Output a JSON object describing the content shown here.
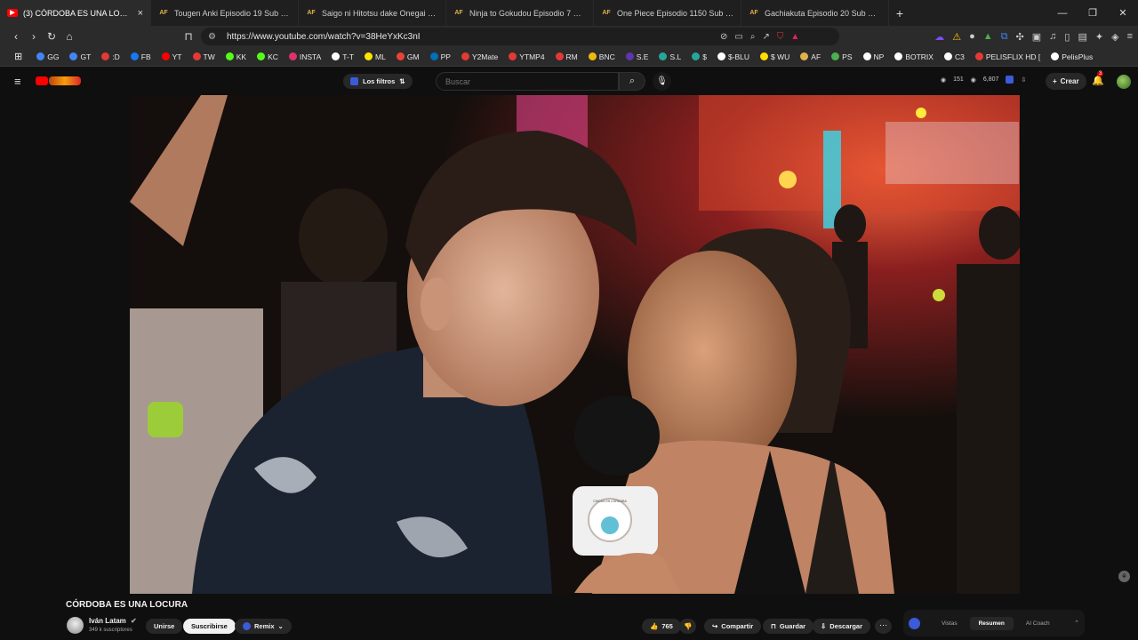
{
  "browser": {
    "tabs": [
      {
        "label": "(3) CÓRDOBA ES UNA LOCURA",
        "favicon": "youtube-favicon",
        "active": true
      },
      {
        "label": "Tougen Anki Episodio 19 Sub Españo",
        "favicon": "animeflv-favicon",
        "active": false
      },
      {
        "label": "Saigo ni Hitotsu dake Onegai shitem",
        "favicon": "animeflv-favicon",
        "active": false
      },
      {
        "label": "Ninja to Gokudou Episodio 7 Sub Esp",
        "favicon": "animeflv-favicon",
        "active": false
      },
      {
        "label": "One Piece Episodio 1150 Sub Españo",
        "favicon": "animeflv-favicon",
        "active": false
      },
      {
        "label": "Gachiakuta Episodio 20 Sub Españo",
        "favicon": "animeflv-favicon",
        "active": false
      }
    ],
    "url": "https://www.youtube.com/watch?v=38HeYxKc3nI",
    "bookmarks": [
      {
        "label": "GG",
        "color": "#4285f4"
      },
      {
        "label": "GT",
        "color": "#4285f4"
      },
      {
        "label": ":D",
        "color": "#e53935"
      },
      {
        "label": "FB",
        "color": "#1877f2"
      },
      {
        "label": "YT",
        "color": "#ff0000"
      },
      {
        "label": "TW",
        "color": "#e53935"
      },
      {
        "label": "KK",
        "color": "#53fc18"
      },
      {
        "label": "KC",
        "color": "#53fc18"
      },
      {
        "label": "INSTA",
        "color": "#e1306c"
      },
      {
        "label": "T-T",
        "color": "#ffffff"
      },
      {
        "label": "ML",
        "color": "#ffe600"
      },
      {
        "label": "GM",
        "color": "#ea4335"
      },
      {
        "label": "PP",
        "color": "#0070ba"
      },
      {
        "label": "Y2Mate",
        "color": "#e53935"
      },
      {
        "label": "YTMP4",
        "color": "#e53935"
      },
      {
        "label": "RM",
        "color": "#e53935"
      },
      {
        "label": "BNC",
        "color": "#f0b90b"
      },
      {
        "label": "S.E",
        "color": "#5e35b1"
      },
      {
        "label": "S.L",
        "color": "#26a69a"
      },
      {
        "label": "$",
        "color": "#26a69a"
      },
      {
        "label": "$-BLU",
        "color": "#ffffff"
      },
      {
        "label": "$ WU",
        "color": "#ffdd00"
      },
      {
        "label": "AF",
        "color": "#e0b24a"
      },
      {
        "label": "PS",
        "color": "#4caf50"
      },
      {
        "label": "NP",
        "color": "#ffffff"
      },
      {
        "label": "BOTRIX",
        "color": "#ffffff"
      },
      {
        "label": "C3",
        "color": "#ffffff"
      },
      {
        "label": "PELISFLIX HD [",
        "color": "#e53935"
      },
      {
        "label": "PelisPlus",
        "color": "#ffffff"
      }
    ]
  },
  "youtube": {
    "filters_label": "Los filtros",
    "search_placeholder": "Buscar",
    "stat_a": "151",
    "stat_b": "6,807",
    "create_label": "Crear",
    "notifications": "3"
  },
  "video": {
    "title": "CÓRDOBA ES UNA LOCURA",
    "channel": "Iván Latam",
    "subscribers": "349 k suscriptores",
    "join_label": "Unirse",
    "subscribe_label": "Suscribirse",
    "remix_label": "Remix",
    "likes": "765",
    "share_label": "Compartir",
    "save_label": "Guardar",
    "download_label": "Descargar",
    "mic_logo_text": "CHICAS EN CÓRDOBA"
  },
  "ai_panel": {
    "tabs": [
      "Vistas",
      "Resumen",
      "AI Coach"
    ],
    "selected": "Resumen"
  }
}
